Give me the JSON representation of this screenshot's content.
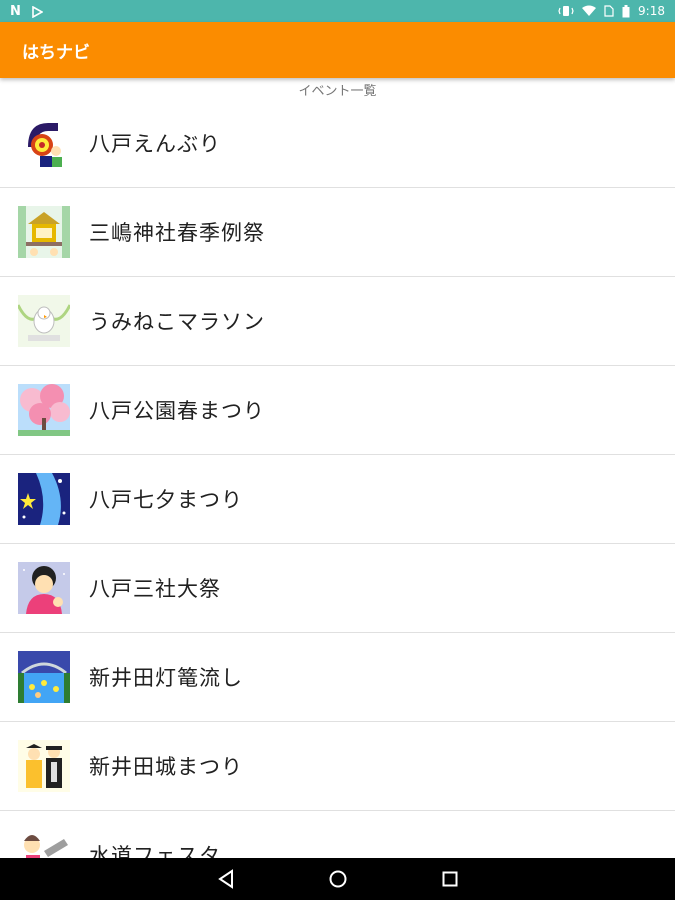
{
  "status_bar": {
    "left_icons": [
      "n-notification-icon",
      "play-store-icon"
    ],
    "right_icons": [
      "vibrate-icon",
      "wifi-icon",
      "no-sim-icon",
      "battery-icon"
    ],
    "n_glyph": "N",
    "time": "9:18"
  },
  "app_bar": {
    "title": "はちナビ",
    "color": "#fb8c00"
  },
  "section": {
    "title": "イベント一覧"
  },
  "events": [
    {
      "label": "八戸えんぶり",
      "icon": "enburi-icon"
    },
    {
      "label": "三嶋神社春季例祭",
      "icon": "shrine-festival-icon"
    },
    {
      "label": "うみねこマラソン",
      "icon": "umineko-icon"
    },
    {
      "label": "八戸公園春まつり",
      "icon": "cherry-blossom-icon"
    },
    {
      "label": "八戸七夕まつり",
      "icon": "tanabata-icon"
    },
    {
      "label": "八戸三社大祭",
      "icon": "sansha-taisai-icon"
    },
    {
      "label": "新井田灯篭流し",
      "icon": "lantern-icon"
    },
    {
      "label": "新井田城まつり",
      "icon": "castle-festival-icon"
    },
    {
      "label": "水道フェスタ",
      "icon": "water-festa-icon"
    }
  ],
  "nav_bar": {
    "buttons": [
      "back-icon",
      "home-icon",
      "recents-icon"
    ]
  }
}
